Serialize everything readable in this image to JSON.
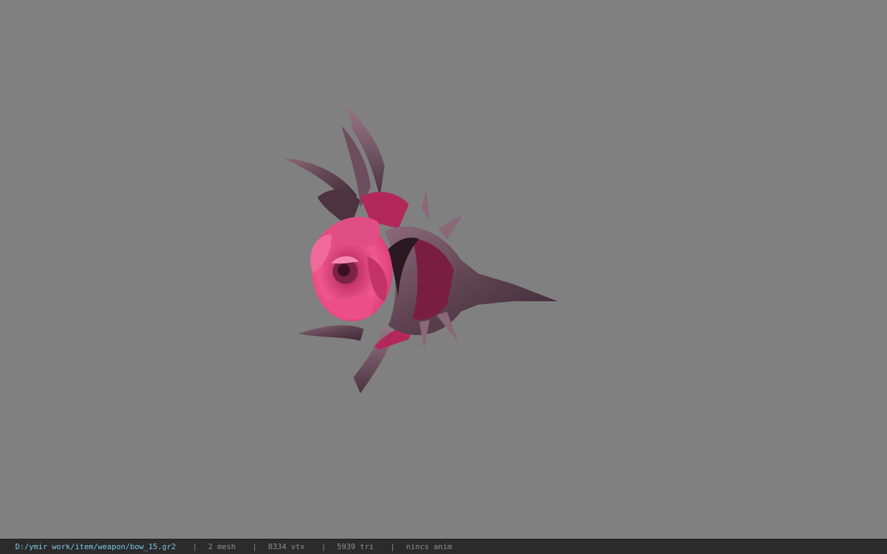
{
  "viewer": {
    "background_color": "#808080",
    "model_name": "bow_15"
  },
  "statusbar": {
    "file_path": "D:/ymir work/item/weapon/bow_15.gr2",
    "separator": "|",
    "mesh_count": "2 mesh",
    "vertex_count": "8334 vtx",
    "triangle_count": "5939 tri",
    "anim_status": "nincs anim"
  },
  "colors": {
    "statusbar_bg": "#2b2b2b",
    "path_text": "#7fc6e6",
    "stat_text": "#8f8f8f",
    "rose_pink": "#e8487f",
    "metal_dark": "#6a4a58"
  }
}
